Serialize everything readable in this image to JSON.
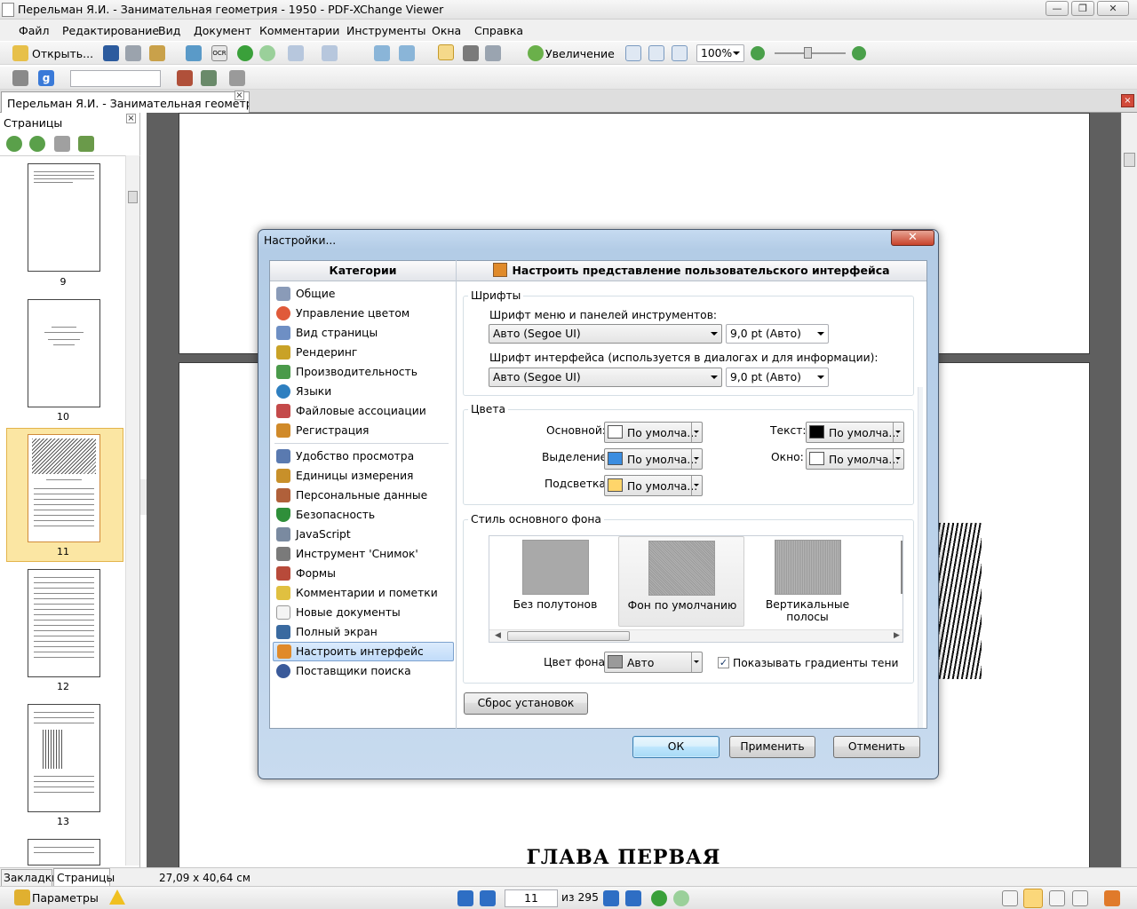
{
  "window": {
    "title": "Перельман Я.И. - Занимательная геометрия - 1950 - PDF-XChange Viewer"
  },
  "menu": [
    "Файл",
    "Редактирование",
    "Вид",
    "Документ",
    "Комментарии",
    "Инструменты",
    "Окна",
    "Справка"
  ],
  "toolbar": {
    "open_label": "Открыть...",
    "ocr_label": "OCR",
    "zoom_label": "Увеличение",
    "zoom_value": "100%"
  },
  "doc_tab": {
    "title": "Перельман Я.И. - Занимательная геометри..."
  },
  "pages_panel": {
    "title": "Страницы",
    "thumbs": [
      "9",
      "10",
      "11",
      "12",
      "13"
    ],
    "tab_bookmarks": "Закладки",
    "tab_pages": "Страницы"
  },
  "document": {
    "chapter_heading": "ГЛАВА ПЕРВАЯ"
  },
  "status": {
    "page_size": "27,09 x 40,64 см"
  },
  "bottombar": {
    "params_label": "Параметры",
    "current_page": "11",
    "of_total": "из 295"
  },
  "dialog": {
    "title": "Настройки...",
    "categories_header": "Категории",
    "section_header": "Настроить представление пользовательского интерфейса",
    "categories_group1": [
      {
        "label": "Общие",
        "color": "#8a9bb8"
      },
      {
        "label": "Управление цветом",
        "color": "#e05a3a"
      },
      {
        "label": "Вид страницы",
        "color": "#6e8fc4"
      },
      {
        "label": "Рендеринг",
        "color": "#c9a227"
      },
      {
        "label": "Производительность",
        "color": "#4a9a4a"
      },
      {
        "label": "Языки",
        "color": "#2e7fc0"
      },
      {
        "label": "Файловые ассоциации",
        "color": "#c44a4a"
      },
      {
        "label": "Регистрация",
        "color": "#d08a2a"
      }
    ],
    "categories_group2": [
      {
        "label": "Удобство просмотра",
        "color": "#5a7ab0"
      },
      {
        "label": "Единицы измерения",
        "color": "#c8902a"
      },
      {
        "label": "Персональные данные",
        "color": "#b0603a"
      },
      {
        "label": "Безопасность",
        "color": "#2f8f3a"
      },
      {
        "label": "JavaScript",
        "color": "#7a8aa0"
      },
      {
        "label": "Инструмент 'Снимок'",
        "color": "#7a7a7a"
      },
      {
        "label": "Формы",
        "color": "#b84a3a"
      },
      {
        "label": "Комментарии и пометки",
        "color": "#e0c040"
      },
      {
        "label": "Новые документы",
        "color": "#d8d8d8"
      },
      {
        "label": "Полный экран",
        "color": "#3a6aa0"
      },
      {
        "label": "Настроить интерфейс",
        "color": "#e08a2a"
      },
      {
        "label": "Поставщики поиска",
        "color": "#3a5a9a"
      }
    ],
    "fonts": {
      "title": "Шрифты",
      "menu_font_label": "Шрифт меню и панелей инструментов:",
      "menu_font_value": "Авто (Segoe UI)",
      "menu_size_value": "9,0 pt (Авто)",
      "ui_font_label": "Шрифт интерфейса (используется в диалогах и для информации):",
      "ui_font_value": "Авто (Segoe UI)",
      "ui_size_value": "9,0 pt (Авто)"
    },
    "colors": {
      "title": "Цвета",
      "main_label": "Основной:",
      "main_value": "По умолча...",
      "main_color": "#ffffff",
      "selection_label": "Выделение:",
      "selection_value": "По умолча...",
      "selection_color": "#3b8de0",
      "highlight_label": "Подсветка:",
      "highlight_value": "По умолча...",
      "highlight_color": "#ffd56a",
      "text_label": "Текст:",
      "text_value": "По умолча...",
      "text_color": "#000000",
      "window_label": "Окно:",
      "window_value": "По умолча...",
      "window_color": "#ffffff"
    },
    "background": {
      "title": "Стиль основного фона",
      "options": [
        "Без полутонов",
        "Фон по умолчанию",
        "Вертикальные полосы"
      ],
      "bg_color_label": "Цвет фона:",
      "bg_color_value": "Авто",
      "bg_color": "#9a9a9a",
      "shadow_label": "Показывать градиенты тени",
      "shadow_checked": true
    },
    "reset_button": "Сброс установок",
    "ok_button": "ОК",
    "apply_button": "Применить",
    "cancel_button": "Отменить"
  }
}
